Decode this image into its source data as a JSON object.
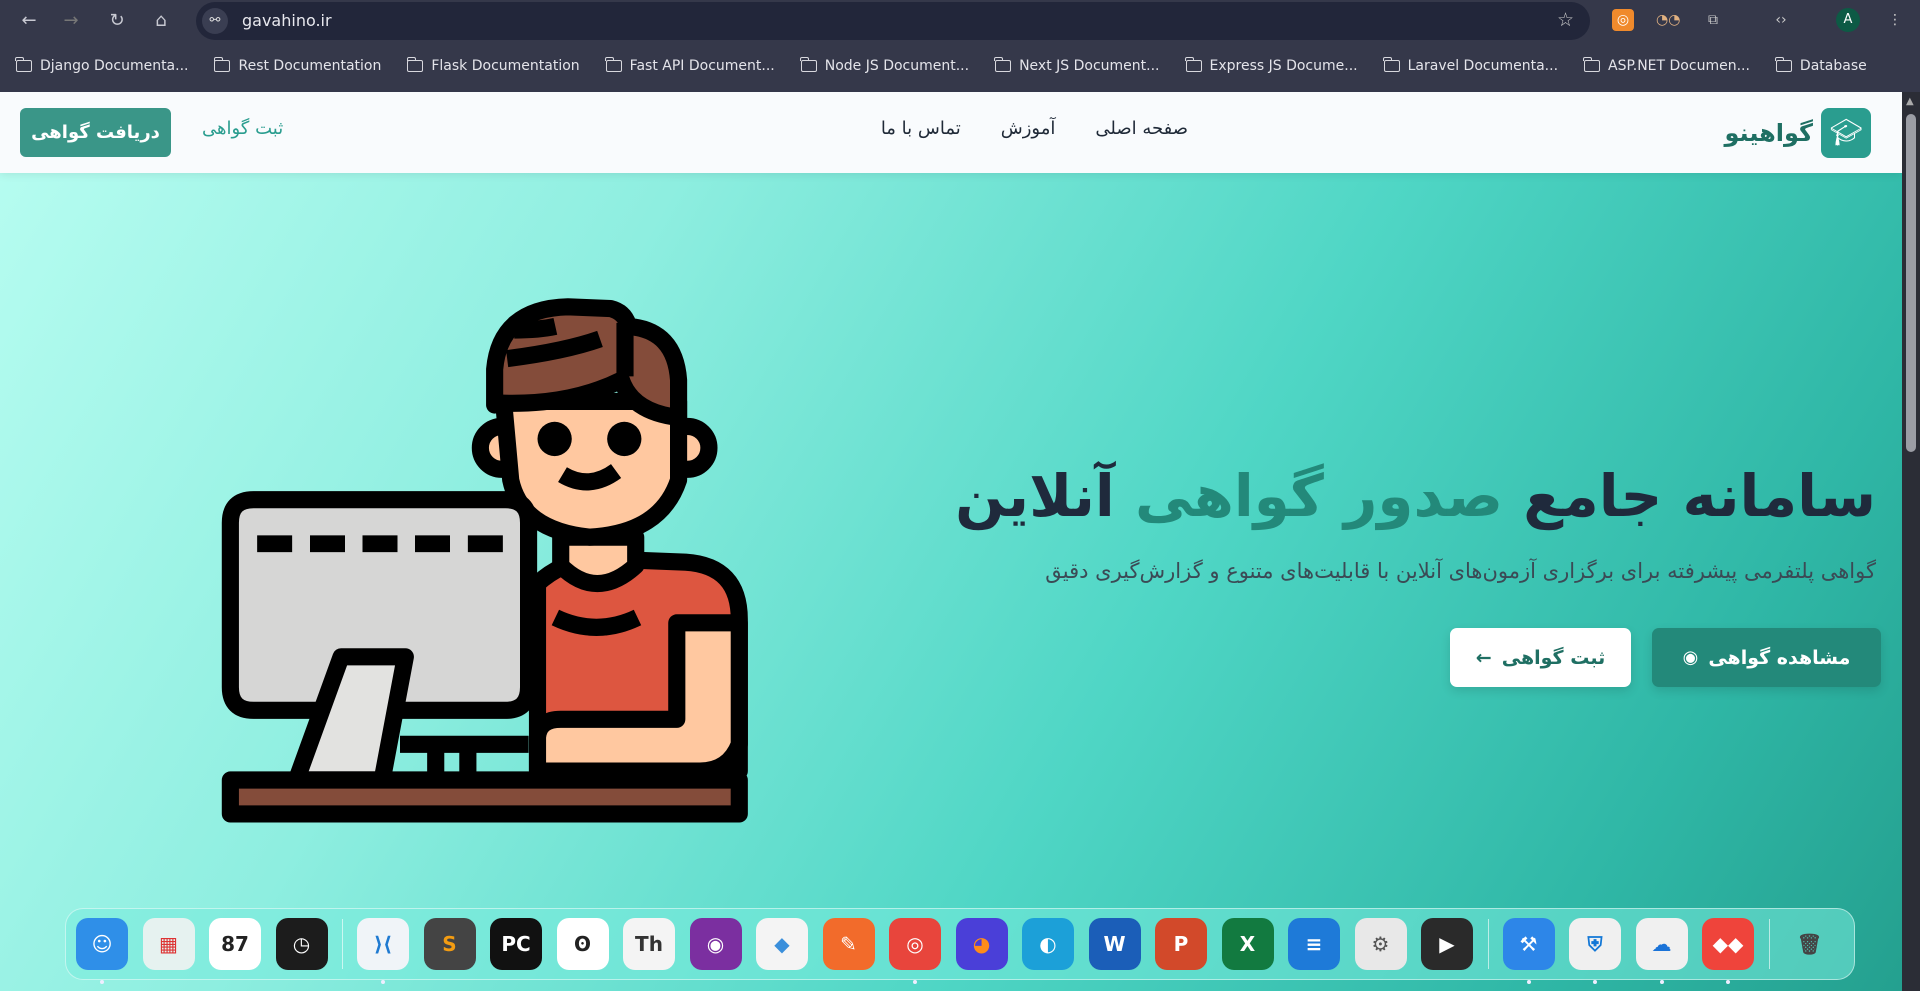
{
  "browser": {
    "url": "gavahino.ir",
    "profile_initial": "A",
    "nav_icons": [
      "back-icon",
      "forward-icon",
      "reload-icon",
      "home-icon"
    ],
    "bookmarks": [
      {
        "label": "Django Documenta..."
      },
      {
        "label": "Rest Documentation"
      },
      {
        "label": "Flask Documentation"
      },
      {
        "label": "Fast API Document..."
      },
      {
        "label": "Node JS Document..."
      },
      {
        "label": "Next JS Document..."
      },
      {
        "label": "Express JS Docume..."
      },
      {
        "label": "Laravel Documenta..."
      },
      {
        "label": "ASP.NET Documen..."
      },
      {
        "label": "Database"
      }
    ]
  },
  "navbar": {
    "brand": "گواهینو",
    "menu": [
      {
        "label": "صفحه اصلی"
      },
      {
        "label": "آموزش"
      },
      {
        "label": "تماس با ما"
      }
    ],
    "register_link": "ثبت گواهی",
    "get_certificate_button": "دریافت گواهی"
  },
  "hero": {
    "title_part1": "سامانه جامع ",
    "title_highlight": "صدور گواهی",
    "title_part2": " آنلاین",
    "subtitle": "گواهی پلتفرمی پیشرفته برای برگزاری آزمون‌های آنلاین با قابلیت‌های متنوع و گزارش‌گیری دقیق",
    "view_button": "مشاهده گواهی",
    "register_button": "ثبت گواهی"
  },
  "colors": {
    "accent": "#2a9d8f",
    "accent_dark": "#23897a",
    "title": "#1f2a3c"
  },
  "dock": {
    "apps": [
      {
        "name": "finder",
        "glyph": "☺",
        "bg": "#2f8fe8",
        "running": true
      },
      {
        "name": "launchpad",
        "glyph": "▦",
        "bg": "#e6f2f0",
        "fg": "#d33",
        "running": false
      },
      {
        "name": "calendar",
        "glyph": "87",
        "bg": "#ffffff",
        "fg": "#222",
        "running": false
      },
      {
        "name": "clock",
        "glyph": "◷",
        "bg": "#1c1c1c",
        "running": false
      },
      {
        "sep": true
      },
      {
        "name": "vscode",
        "glyph": "⟩⟨",
        "bg": "#f0f4f8",
        "fg": "#1f7ad1",
        "running": true
      },
      {
        "name": "sublime-text",
        "glyph": "S",
        "bg": "#444",
        "fg": "#f39c12",
        "running": false
      },
      {
        "name": "pycharm",
        "glyph": "PC",
        "bg": "#111",
        "fg": "#fff",
        "running": false
      },
      {
        "name": "bunny-app",
        "glyph": "ʘ",
        "bg": "#fff",
        "fg": "#222",
        "running": false
      },
      {
        "name": "typora",
        "glyph": "Th",
        "bg": "#f4f4f4",
        "fg": "#333",
        "running": false
      },
      {
        "name": "github-desktop",
        "glyph": "◉",
        "bg": "#7b2fa0",
        "running": false
      },
      {
        "name": "git-app",
        "glyph": "◆",
        "bg": "#f4f4f4",
        "fg": "#3a8fdb",
        "running": false
      },
      {
        "name": "vectornator",
        "glyph": "✎",
        "bg": "#f26b2b",
        "running": false
      },
      {
        "name": "chrome",
        "glyph": "◎",
        "bg": "#e8453c",
        "running": true
      },
      {
        "name": "firefox",
        "glyph": "◕",
        "bg": "#4a3fd8",
        "fg": "#ff8c1a",
        "running": false
      },
      {
        "name": "edge",
        "glyph": "◐",
        "bg": "#1ca0d8",
        "running": false
      },
      {
        "name": "word",
        "glyph": "W",
        "bg": "#1b5eb8",
        "running": false
      },
      {
        "name": "powerpoint",
        "glyph": "P",
        "bg": "#d2492a",
        "running": false
      },
      {
        "name": "excel",
        "glyph": "X",
        "bg": "#127a40",
        "running": false
      },
      {
        "name": "notes",
        "glyph": "≡",
        "bg": "#1e7ad8",
        "running": false
      },
      {
        "name": "system-settings",
        "glyph": "⚙",
        "bg": "#e8e8e8",
        "fg": "#555",
        "running": false
      },
      {
        "name": "infuse",
        "glyph": "▶",
        "bg": "#2a2a2a",
        "running": false
      },
      {
        "sep": true
      },
      {
        "name": "xcode",
        "glyph": "⚒",
        "bg": "#2d86e8",
        "running": true
      },
      {
        "name": "defender",
        "glyph": "⛨",
        "bg": "#f0f0f0",
        "fg": "#1277d6",
        "running": true
      },
      {
        "name": "onedrive",
        "glyph": "☁",
        "bg": "#f0f0f0",
        "fg": "#1a73d8",
        "running": true
      },
      {
        "name": "anydesk",
        "glyph": "◆◆",
        "bg": "#ef443b",
        "running": true
      },
      {
        "sep": true
      },
      {
        "name": "trash",
        "glyph": "🗑",
        "bg": "transparent",
        "fg": "#444",
        "running": false
      }
    ]
  }
}
